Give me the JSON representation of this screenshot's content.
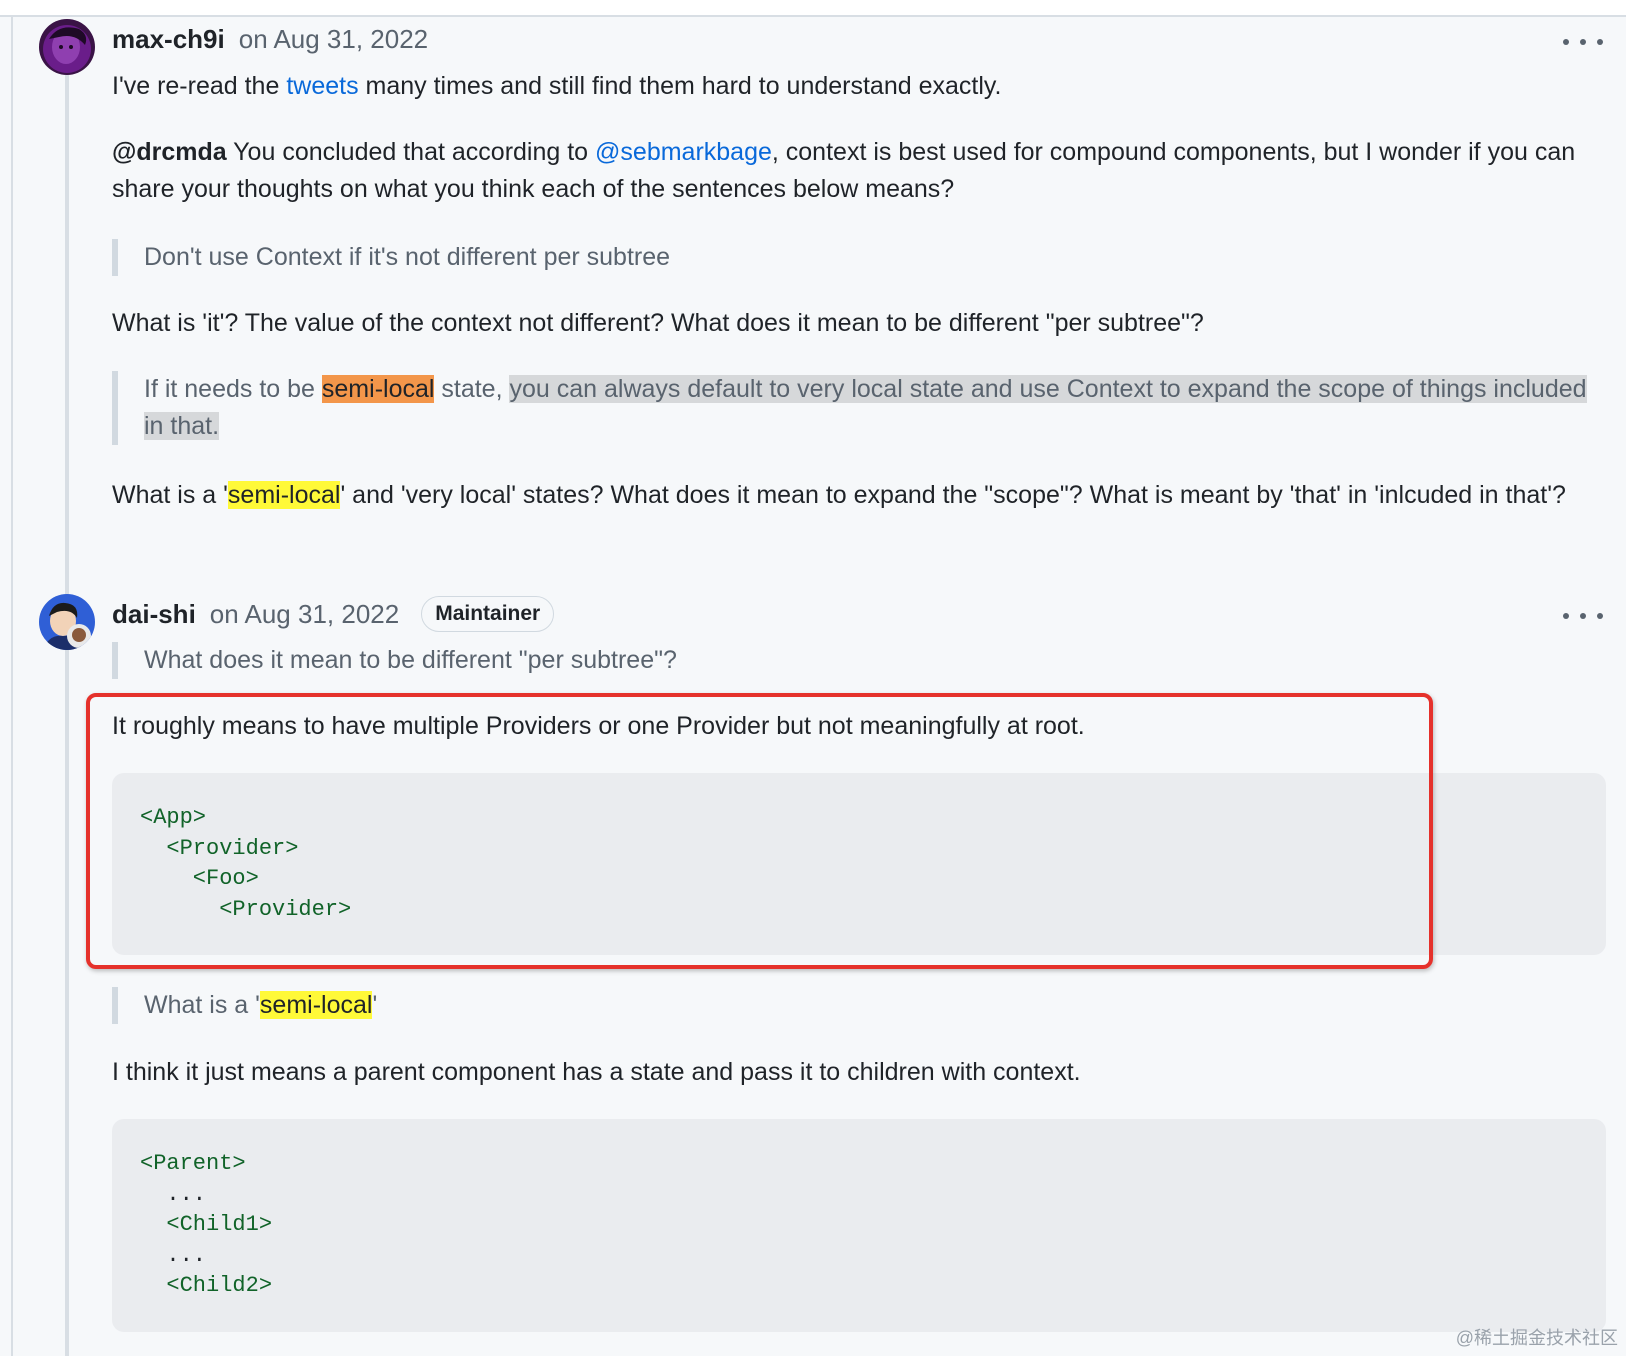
{
  "comment1": {
    "author": "max-ch9i",
    "date": "on Aug 31, 2022",
    "para1": {
      "before": "I've re-read the ",
      "link": "tweets",
      "after": " many times and still find them hard to understand exactly."
    },
    "para2": {
      "mention": "@drcmda",
      "text1": " You concluded that according to ",
      "mention2": "@sebmarkbage",
      "text2": ", context is best used for compound components, but I wonder if you can share your thoughts on what you think each of the sentences below means?"
    },
    "quote1": "Don't use Context if it's not different per subtree",
    "para3": "What is 'it'? The value of the context not different? What does it mean to be different \"per subtree\"?",
    "quote2": {
      "before": "If it needs to be ",
      "highlight": "semi-local",
      "middle": " state, ",
      "selected": "you can always default to very local state and use Context to expand the scope of things included in that."
    },
    "para4": {
      "before": "What is a '",
      "highlight": "semi-local",
      "after": "' and 'very local' states? What does it mean to expand the \"scope\"? What is meant by 'that' in 'inlcuded in that'?"
    }
  },
  "comment2": {
    "author": "dai-shi",
    "date": "on Aug 31, 2022",
    "badge": "Maintainer",
    "quote1": "What does it mean to be different \"per subtree\"?",
    "para1": "It roughly means to have multiple Providers or one Provider but not meaningfully at root.",
    "code1": [
      "<App>",
      "  <Provider>",
      "    <Foo>",
      "      <Provider>"
    ],
    "quote2": {
      "before": "What is a '",
      "highlight": "semi-local",
      "after": "'"
    },
    "para2": "I think it just means a parent component has a state and pass it to children with context.",
    "code2": [
      "<Parent>",
      "  ...",
      "  <Child1>",
      "  ...",
      "  <Child2>"
    ]
  },
  "watermark": "@稀土掘金技术社区",
  "icons": {
    "menu": "kebab-horizontal-icon"
  },
  "colors": {
    "link": "#0969da",
    "highlight_orange": "#f3964a",
    "highlight_yellow": "#fff938",
    "annotation_box": "#e5312b"
  }
}
